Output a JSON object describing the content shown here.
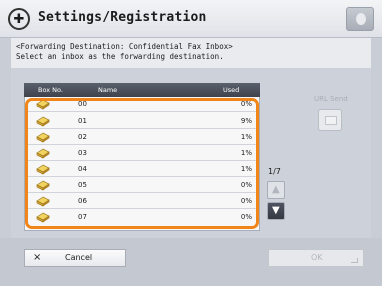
{
  "title": "Settings/Registration",
  "header": {
    "line1": "<Forwarding Destination: Confidential Fax Inbox>",
    "line2": "Select an inbox as the forwarding destination."
  },
  "table": {
    "columns": {
      "box": "Box No.",
      "name": "Name",
      "used": "Used"
    },
    "rows": [
      {
        "box_no": "00",
        "used": "0%"
      },
      {
        "box_no": "01",
        "used": "9%"
      },
      {
        "box_no": "02",
        "used": "1%"
      },
      {
        "box_no": "03",
        "used": "1%"
      },
      {
        "box_no": "04",
        "used": "1%"
      },
      {
        "box_no": "05",
        "used": "0%"
      },
      {
        "box_no": "06",
        "used": "0%"
      },
      {
        "box_no": "07",
        "used": "0%"
      }
    ]
  },
  "pagination": {
    "page": "1/7"
  },
  "side": {
    "url_send_label": "URL Send"
  },
  "footer": {
    "cancel": "Cancel",
    "ok": "OK"
  },
  "colors": {
    "accent": "#f0861a",
    "header_dark": "#3e434d"
  },
  "icons": {
    "title": "settings-registration-icon",
    "row": "box-icon",
    "up": "scroll-up-icon",
    "down": "scroll-down-icon",
    "cancel": "close-icon"
  }
}
